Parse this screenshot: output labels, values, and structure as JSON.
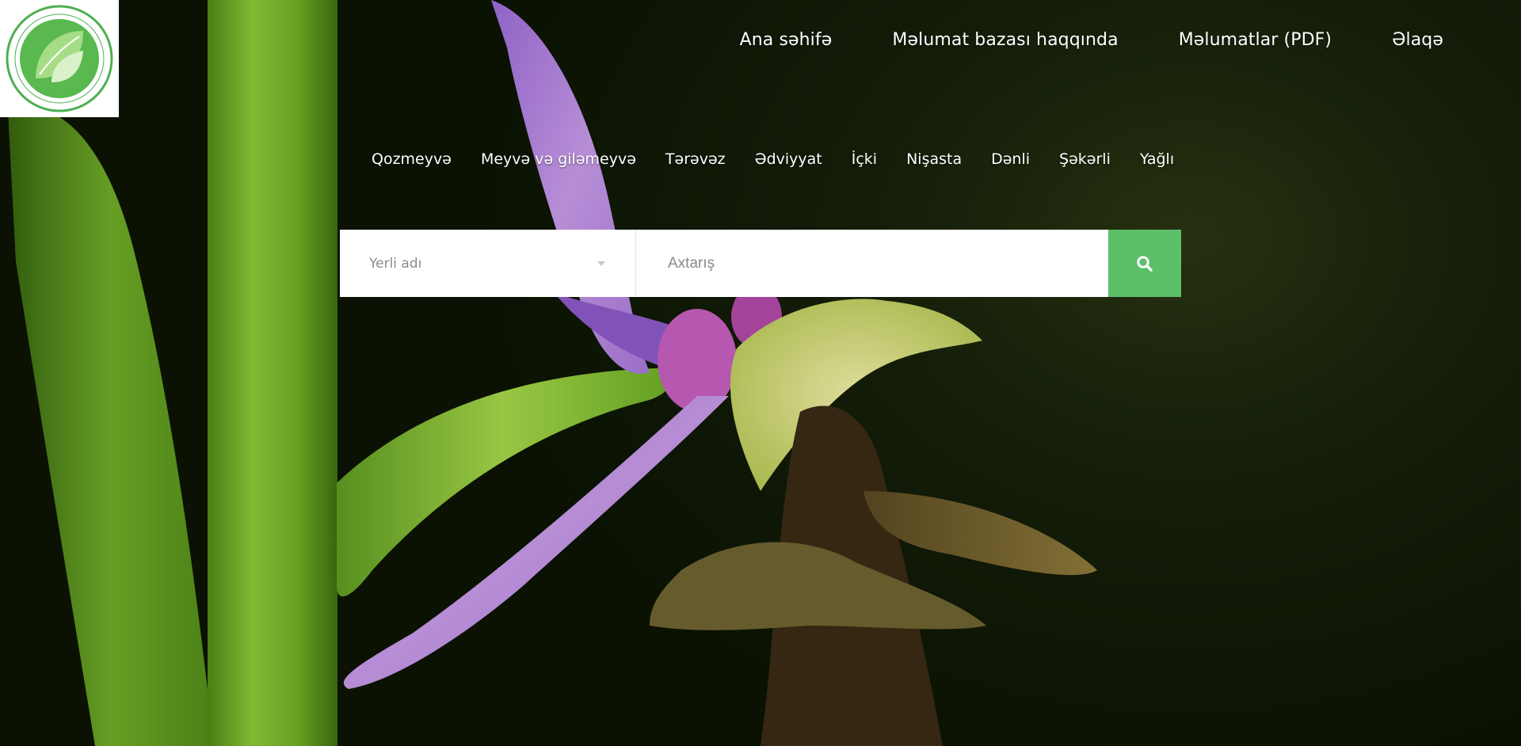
{
  "top_nav": [
    {
      "label": "Ana səhifə"
    },
    {
      "label": "Məlumat bazası haqqında"
    },
    {
      "label": "Məlumatlar (PDF)"
    },
    {
      "label": "Əlaqə"
    }
  ],
  "categories": [
    {
      "label": "Qozmeyvə"
    },
    {
      "label": "Meyvə və giləmeyvə"
    },
    {
      "label": "Tərəvəz"
    },
    {
      "label": "Ədviyyat"
    },
    {
      "label": "İçki"
    },
    {
      "label": "Nişasta"
    },
    {
      "label": "Dənli"
    },
    {
      "label": "Şəkərli"
    },
    {
      "label": "Yağlı"
    }
  ],
  "search": {
    "select_value": "Yerli adı",
    "placeholder": "Axtarış"
  },
  "colors": {
    "accent": "#5cbf6a",
    "logo_green": "#4caf50"
  }
}
